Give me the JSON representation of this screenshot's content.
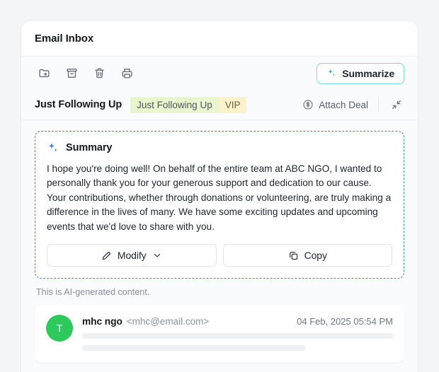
{
  "header": {
    "title": "Email Inbox"
  },
  "toolbar": {
    "icons": [
      {
        "name": "folder-move-icon"
      },
      {
        "name": "archive-icon"
      },
      {
        "name": "trash-icon"
      },
      {
        "name": "print-icon"
      }
    ],
    "summarize_label": "Summarize"
  },
  "subject": {
    "title": "Just Following Up",
    "tags": [
      {
        "label": "Just Following Up",
        "color": "#e9f5cf"
      },
      {
        "label": "VIP",
        "color": "#faf2cb"
      }
    ],
    "attach_deal_label": "Attach Deal"
  },
  "summary": {
    "title": "Summary",
    "text": "I hope you're doing well! On behalf of the entire team at ABC NGO, I wanted to personally thank you for your generous support and dedication to our cause. Your contributions, whether through donations or volunteering, are truly making a difference in the lives of many. We have some exciting updates and upcoming events that we'd love to share with you.",
    "modify_label": "Modify",
    "copy_label": "Copy",
    "ai_note": "This is AI-generated content.",
    "accent_color": "#4a7fd4"
  },
  "message": {
    "avatar_initial": "T",
    "avatar_color": "#2dc95d",
    "sender_name": "mhc ngo",
    "sender_email": "<mhc@email.com>",
    "timestamp": "04 Feb, 2025  05:54 PM"
  }
}
